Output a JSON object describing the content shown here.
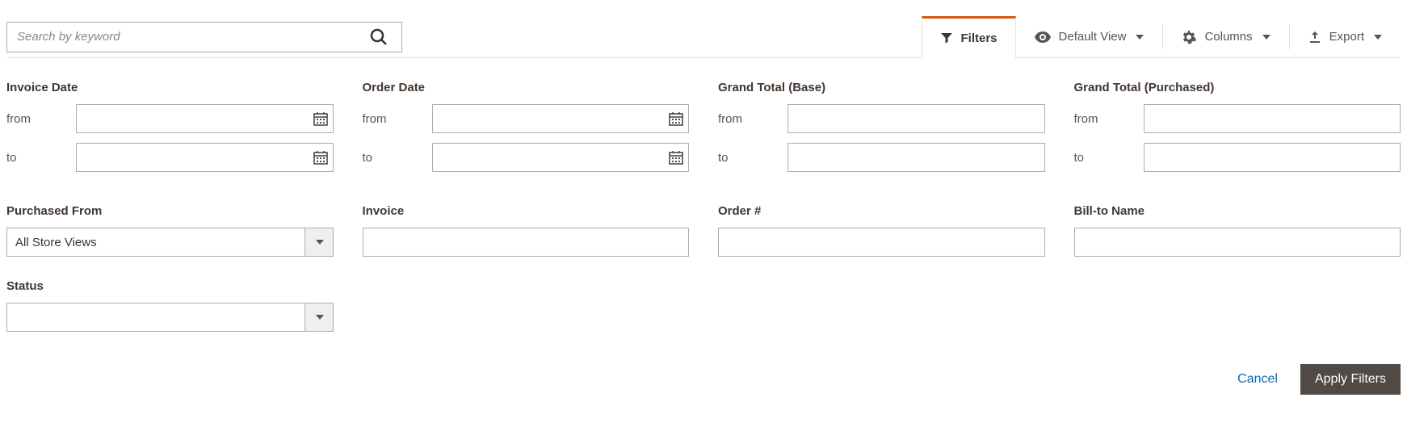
{
  "search": {
    "placeholder": "Search by keyword"
  },
  "toolbar": {
    "filters": "Filters",
    "default_view": "Default View",
    "columns": "Columns",
    "export": "Export"
  },
  "filters": {
    "invoice_date": {
      "title": "Invoice Date",
      "from_label": "from",
      "to_label": "to",
      "from": "",
      "to": ""
    },
    "order_date": {
      "title": "Order Date",
      "from_label": "from",
      "to_label": "to",
      "from": "",
      "to": ""
    },
    "grand_total_base": {
      "title": "Grand Total (Base)",
      "from_label": "from",
      "to_label": "to",
      "from": "",
      "to": ""
    },
    "grand_total_purchased": {
      "title": "Grand Total (Purchased)",
      "from_label": "from",
      "to_label": "to",
      "from": "",
      "to": ""
    },
    "purchased_from": {
      "title": "Purchased From",
      "value": "All Store Views"
    },
    "invoice": {
      "title": "Invoice",
      "value": ""
    },
    "order_number": {
      "title": "Order #",
      "value": ""
    },
    "bill_to_name": {
      "title": "Bill-to Name",
      "value": ""
    },
    "status": {
      "title": "Status",
      "value": ""
    }
  },
  "actions": {
    "cancel": "Cancel",
    "apply": "Apply Filters"
  }
}
